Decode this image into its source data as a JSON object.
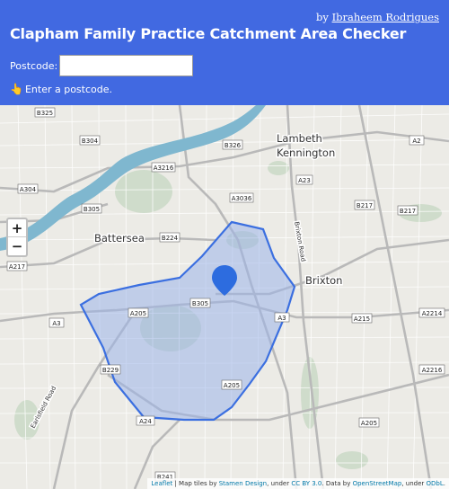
{
  "header": {
    "byline_prefix": "by",
    "byline_author": "Ibraheem Rodrigues",
    "title": "Clapham Family Practice Catchment Area Checker",
    "postcode_label": "Postcode:",
    "postcode_value": "",
    "status_icon": "👆",
    "status_text": "Enter a postcode."
  },
  "map": {
    "zoom_in": "+",
    "zoom_out": "−",
    "places": [
      "Battersea",
      "Lambeth",
      "Kennington",
      "Brixton"
    ],
    "road_labels": [
      "B325",
      "B304",
      "B326",
      "A2",
      "A3216",
      "A23",
      "A304",
      "B305",
      "A3036",
      "B217",
      "B217",
      "B224",
      "A217",
      "A3",
      "B305",
      "A3",
      "A215",
      "A2214",
      "A205",
      "A205",
      "B229",
      "A2216",
      "A24",
      "A205",
      "B241",
      "Brixton Road",
      "Earlsfield Road"
    ],
    "catchment_color": "#3b6fe0",
    "catchment_fill": "#9db5ea",
    "marker_color": "#2d6cdf",
    "river_color": "#7fb7cf"
  },
  "attribution": {
    "leaflet": "Leaflet",
    "text1": " | Map tiles by ",
    "stamen": "Stamen Design",
    "text2": ", under ",
    "ccby": "CC BY 3.0",
    "text3": ". Data by ",
    "osm": "OpenStreetMap",
    "text4": ", under ",
    "odbl": "ODbL",
    "text5": "."
  }
}
